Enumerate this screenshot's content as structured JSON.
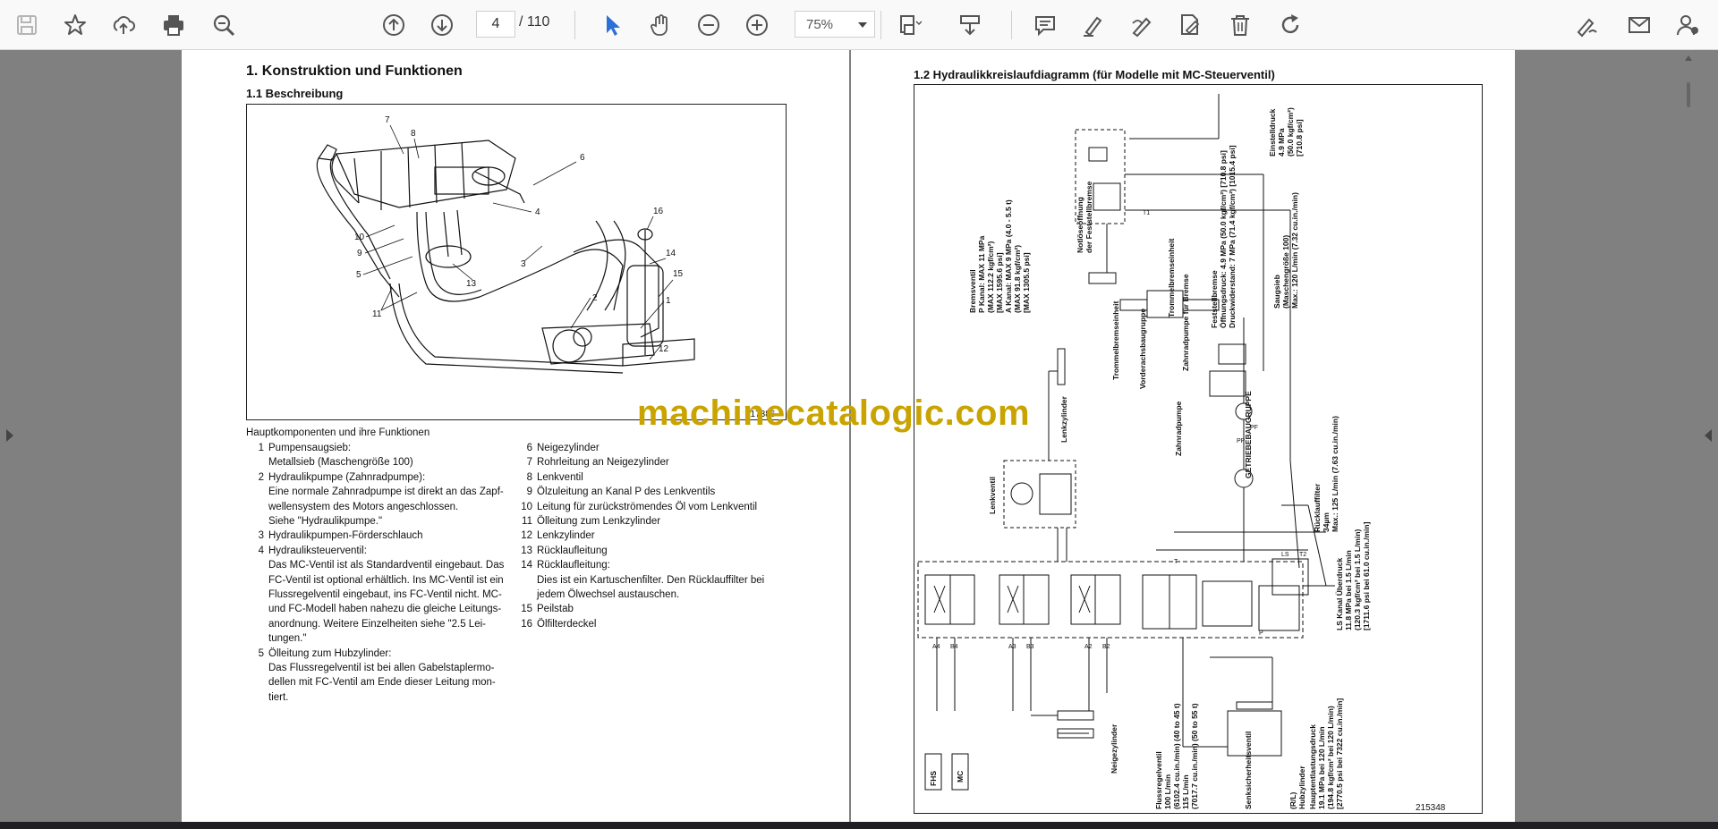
{
  "toolbar": {
    "left_icons": [
      "save-icon",
      "bookmark-star-icon",
      "upload-icon",
      "print-icon",
      "zoom-out-search-icon"
    ],
    "nav_icons": [
      "page-up-icon",
      "page-down-icon"
    ],
    "page_current": "4",
    "page_total": "/ 110",
    "tool_icons": [
      "select-cursor-icon",
      "hand-icon",
      "zoom-minus-icon",
      "zoom-plus-icon"
    ],
    "zoom_value": "75%",
    "right_icons": [
      "fit-page-icon",
      "insert-page-icon",
      "comment-icon",
      "highlighter-icon",
      "freehand-pen-icon",
      "edit-page-icon",
      "trash-icon",
      "redo-icon"
    ],
    "far_right_icons": [
      "sign-pen-icon",
      "mail-icon",
      "account-icon"
    ]
  },
  "left_page": {
    "section_title": "1.  Konstruktion und Funktionen",
    "subsection_title": "1.1   Beschreibung",
    "figure_labels": [
      "7",
      "8",
      "6",
      "16",
      "4",
      "10",
      "9",
      "5",
      "13",
      "3",
      "14",
      "15",
      "11",
      "2",
      "1",
      "12"
    ],
    "figure_code": "217386",
    "components_heading": "Hauptkomponenten und ihre Funktionen",
    "col1": [
      {
        "num": "1",
        "text": "Pumpensaugsieb:"
      },
      {
        "num": "",
        "text": "Metallsieb (Maschengröße 100)"
      },
      {
        "num": "2",
        "text": "Hydraulikpumpe (Zahnradpumpe):"
      },
      {
        "num": "",
        "text": "Eine normale Zahnradpumpe ist direkt an das Zapf-"
      },
      {
        "num": "",
        "text": "wellensystem des Motors angeschlossen."
      },
      {
        "num": "",
        "text": "Siehe \"Hydraulikpumpe.\""
      },
      {
        "num": "3",
        "text": "Hydraulikpumpen-Förderschlauch"
      },
      {
        "num": "4",
        "text": "Hydrauliksteuerventil:"
      },
      {
        "num": "",
        "text": "Das MC-Ventil ist als Standardventil eingebaut. Das"
      },
      {
        "num": "",
        "text": "FC-Ventil ist optional erhältlich. Ins MC-Ventil ist ein"
      },
      {
        "num": "",
        "text": "Flussregelventil eingebaut, ins FC-Ventil nicht. MC-"
      },
      {
        "num": "",
        "text": "und FC-Modell haben nahezu die gleiche Leitungs-"
      },
      {
        "num": "",
        "text": "anordnung. Weitere Einzelheiten siehe \"2.5 Lei-"
      },
      {
        "num": "",
        "text": "tungen.\""
      },
      {
        "num": "5",
        "text": "Ölleitung zum Hubzylinder:"
      },
      {
        "num": "",
        "text": "Das Flussregelventil ist bei allen Gabelstaplermo-"
      },
      {
        "num": "",
        "text": "dellen mit FC-Ventil am Ende dieser Leitung mon-"
      },
      {
        "num": "",
        "text": "tiert."
      }
    ],
    "col2": [
      {
        "num": "6",
        "text": "Neigezylinder"
      },
      {
        "num": "7",
        "text": "Rohrleitung an Neigezylinder"
      },
      {
        "num": "8",
        "text": "Lenkventil"
      },
      {
        "num": "9",
        "text": "Ölzuleitung an Kanal P des Lenkventils"
      },
      {
        "num": "10",
        "text": "Leitung für zurückströmendes Öl vom Lenkventil"
      },
      {
        "num": "11",
        "text": "Ölleitung zum Lenkzylinder"
      },
      {
        "num": "12",
        "text": "Lenkzylinder"
      },
      {
        "num": "13",
        "text": "Rücklaufleitung"
      },
      {
        "num": "14",
        "text": "Rücklaufleitung:"
      },
      {
        "num": "",
        "text": "Dies ist ein Kartuschenfilter. Den Rücklauffilter bei"
      },
      {
        "num": "",
        "text": "jedem Ölwechsel austauschen."
      },
      {
        "num": "15",
        "text": "Peilstab"
      },
      {
        "num": "16",
        "text": "Ölfilterdeckel"
      }
    ]
  },
  "right_page": {
    "title": "1.2   Hydraulikkreislaufdiagramm (für Modelle mit MC-Steuerventil)",
    "figure_code": "215348",
    "labels": {
      "einstelldruck": [
        "Einstelldruck",
        "4.9 MPa",
        "(50.0 kgf/cm²)",
        "[710.8 psi]"
      ],
      "notloese": [
        "Notlöseöffnung",
        "der Feststellbremse"
      ],
      "bremsventil": [
        "Bremsventil",
        "P Kanal: MAX 11 MPa",
        "(MAX 112.2 kgf/cm²)",
        "[MAX 1595.6 psi]",
        "A Kanal: MAX 9 MPa (4.0 - 5.5 t)",
        "(MAX 91.8 kgf/cm²)",
        "[MAX 1305.5 psi]"
      ],
      "trommel": "Trommelbremseinheit",
      "vorderachs": "Vorderachsbaugruppe",
      "zahnradpumpe_bremse": "Zahnradpumpe für Bremse",
      "feststellbremse": [
        "Feststellbremse",
        "Öffnungsdruck: 4.9 MPa (50.0 kgf/cm²) [710.8 psi]",
        "Druckwiderstand: 7 MPa (71.4 kgf/cm²) [1015.4 psi]"
      ],
      "saugsieb": [
        "Saugsieb",
        "(Maschengröße 100)",
        "Max.: 120 L/min (7.32 cu.in./min)"
      ],
      "getriebe": "GETRIEBEBAUGRUPPE",
      "lenkzylinder": "Lenkzylinder",
      "lenkventil": "Lenkventil",
      "zahnradpumpe": "Zahnradpumpe",
      "ruecklauf": [
        "Rücklauffilter",
        "34µm",
        "Max.: 125 L/min (7.63 cu.in./min)"
      ],
      "ls_kanal": [
        "LS Kanal Überdruck",
        "11.8 MPa bei 1.5 L/min",
        "(120.3 kgf/cm² bei 1.5 L/min)",
        "[1711.6 psi bei 61.0 cu.in./min]"
      ],
      "hauptentlastung": [
        "Hauptentlastungsdruck",
        "19.1 MPa bei 120 L/min",
        "(194.8 kgf/cm² bei 120 L/min)",
        "[2770.5 psi bei 7322 cu.in./min]"
      ],
      "hubzylinder": [
        "(R/L)",
        "Hubzylinder"
      ],
      "senksicherheit": "Senksicherheitsventil",
      "flussregel": [
        "Flussregelventil",
        "100 L/min",
        "(6102.4 cu.in./min) (40 to 45 t)",
        "115 L/min",
        "(7017.7 cu.in./min) (50 to 55 t)"
      ],
      "neigezylinder": "Neigezylinder",
      "fhs": "FHS",
      "mc": "MC",
      "ports": [
        "A4",
        "B4",
        "A3",
        "B3",
        "A2",
        "B2",
        "LS",
        "T2",
        "P",
        "PP",
        "PF",
        "T",
        "T1"
      ]
    }
  },
  "watermark": "machinecatalogic.com"
}
